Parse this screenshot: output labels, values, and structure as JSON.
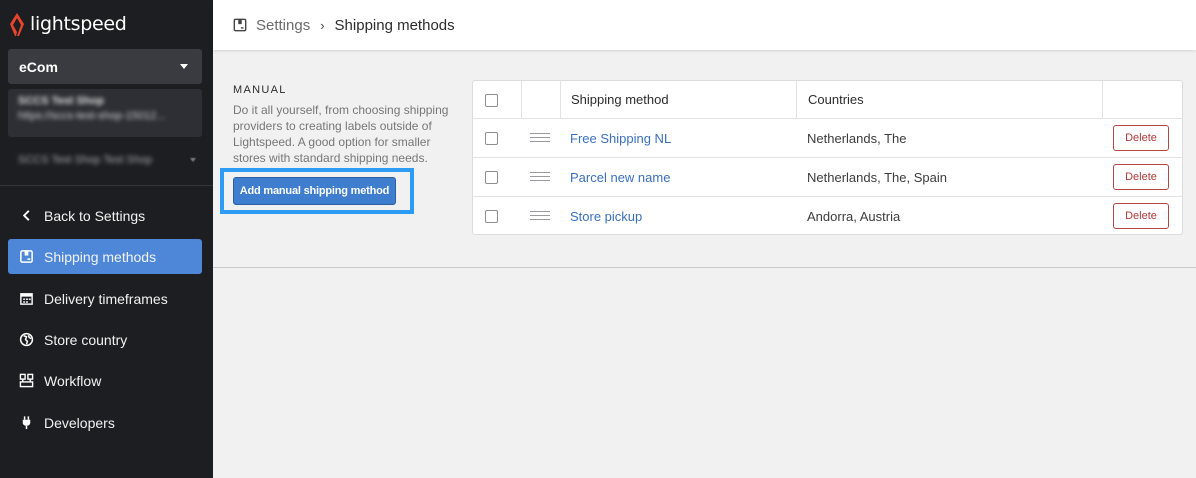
{
  "brand": {
    "name": "lightspeed",
    "accent": "#e8452c"
  },
  "sidebar": {
    "store_select": "eCom",
    "shop": {
      "name": "SCCS Test Shop",
      "url": "https://sccs-test-shop-15012..."
    },
    "alt_shop": "SCCS Test Shop Test Shop",
    "items": [
      {
        "label": "Back to Settings",
        "icon": "chevron-left-icon"
      },
      {
        "label": "Shipping methods",
        "icon": "box-icon",
        "active": true
      },
      {
        "label": "Delivery timeframes",
        "icon": "calendar-icon"
      },
      {
        "label": "Store country",
        "icon": "globe-icon"
      },
      {
        "label": "Workflow",
        "icon": "workflow-icon"
      },
      {
        "label": "Developers",
        "icon": "plug-icon"
      }
    ],
    "active_color": "#4e87d8"
  },
  "header": {
    "breadcrumb_root": "Settings",
    "breadcrumb_current": "Shipping methods",
    "separator": "›"
  },
  "manual": {
    "label": "MANUAL",
    "description": "Do it all yourself, from choosing shipping providers to creating labels outside of Lightspeed. A good option for smaller stores with standard shipping needs.",
    "add_button": "Add manual shipping method",
    "button_color": "#3f7dcf"
  },
  "table": {
    "columns": [
      "Shipping method",
      "Countries"
    ],
    "rows": [
      {
        "method": "Free Shipping NL",
        "countries": "Netherlands, The",
        "delete": "Delete"
      },
      {
        "method": "Parcel new name",
        "countries": "Netherlands, The, Spain",
        "delete": "Delete"
      },
      {
        "method": "Store pickup",
        "countries": "Andorra, Austria",
        "delete": "Delete"
      }
    ]
  }
}
